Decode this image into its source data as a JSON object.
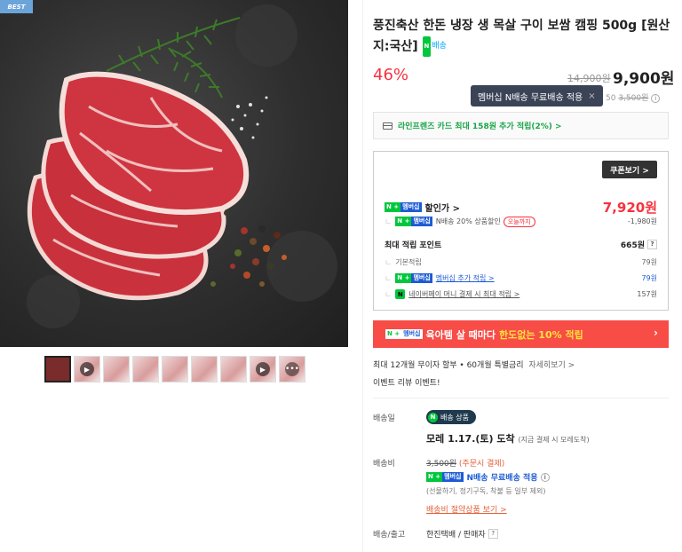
{
  "hero": {
    "badge": "BEST",
    "image_alt": "Sliced raw pork neck meat with rosemary, salt and peppercorns on dark slate"
  },
  "thumbnails": [
    {
      "kind": "image",
      "selected": true
    },
    {
      "kind": "video"
    },
    {
      "kind": "image"
    },
    {
      "kind": "image"
    },
    {
      "kind": "image"
    },
    {
      "kind": "image"
    },
    {
      "kind": "image"
    },
    {
      "kind": "video"
    },
    {
      "kind": "more"
    }
  ],
  "product": {
    "title": "풍진축산 한돈 냉장 생 목살 구이 보쌈 캠핑 500g [원산지:국산]",
    "npay_chip": "배송",
    "discount": "46%",
    "original_price": "14,900원",
    "price": "9,900원"
  },
  "tooltip": {
    "text": "멤버십 N배송 무료배송 적용",
    "close": "×"
  },
  "shipping_fee_line": {
    "prefix": "50",
    "strike": "3,500원"
  },
  "card_benefit": {
    "text": "라인프렌즈 카드 최대 158원 추가 적립(2%) >"
  },
  "points": {
    "coupon_button": "쿠폰보기 >",
    "discount_label": "할인가 >",
    "discount_value": "7,920원",
    "nship_label": "N배송 20% 상품할인",
    "nship_tag": "오늘까지",
    "nship_value": "-1,980원",
    "max_label": "최대 적립 포인트",
    "max_value": "665원",
    "basic_label": "기본적립",
    "basic_value": "79원",
    "member_label": "멤버십 추가 적립 >",
    "member_value": "79원",
    "npay_label": "네이버페이 머니 결제 시 최대 적립 >",
    "npay_value": "157원",
    "badge_n": "N +",
    "badge_m": "멤버십"
  },
  "promo": {
    "text": "육아템 살 때마다",
    "highlight": "한도없는 10% 적립",
    "arrow": "›"
  },
  "installment": {
    "text": "최대 12개월 무이자 할부 • 60개월 특별금리",
    "link": "자세히보기 >"
  },
  "event": {
    "text": "이벤트 리뷰 이벤트!"
  },
  "delivery": {
    "label_date": "배송일",
    "chip": "배송 상품",
    "chip_n": "N",
    "arrival": "모레 1.17.(토) 도착",
    "arrival_sub": "(지금 결제 시 모레도착)",
    "label_fee": "배송비",
    "fee_strike": "3,500원",
    "fee_note": "(주문시 결제)",
    "member_free": "N배송 무료배송 적용",
    "member_note": "(선물하기, 정기구독, 착불 등 일부 제외)",
    "saving_link": "배송비 절약상품 보기 >",
    "label_company": "배송/출고",
    "company": "한진택배 / 판매자"
  },
  "colors": {
    "discount_red": "#f7323f",
    "naver_green": "#00c73c",
    "promo_bg": "#f84c47",
    "promo_highlight": "#ffe23c"
  }
}
